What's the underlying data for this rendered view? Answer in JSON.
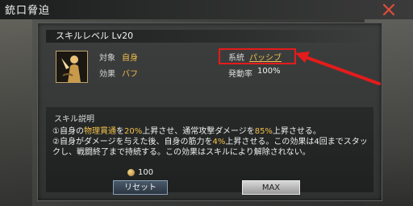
{
  "window": {
    "title": "銃口脅迫",
    "close_icon": "close-icon"
  },
  "skill": {
    "level_label": "スキルレベル Lv20",
    "target_label": "対象",
    "target_value": "自身",
    "effect_label": "効果",
    "effect_value": "バフ",
    "lineage_label": "系統",
    "lineage_value": "パッシブ",
    "rate_label": "発動率",
    "rate_value": "100%"
  },
  "description": {
    "title": "スキル説明",
    "line1_parts": [
      "①自身の",
      "物理貫通",
      "を",
      "20%",
      "上昇させ、通常攻撃ダメージを",
      "85%",
      "上昇させる。"
    ],
    "line2_parts": [
      "②自身がダメージを与えた後、自身の筋力を",
      "4%",
      "上昇させる。この効果は4回までスタックし、戦闘終了まで持続する。この効果はスキルにより解除されない。"
    ]
  },
  "footer": {
    "cost_value": "100",
    "reset_label": "リセット",
    "max_label": "MAX"
  },
  "colors": {
    "accent_gold": "#f2c04a",
    "highlight_red": "#e51b1b"
  }
}
